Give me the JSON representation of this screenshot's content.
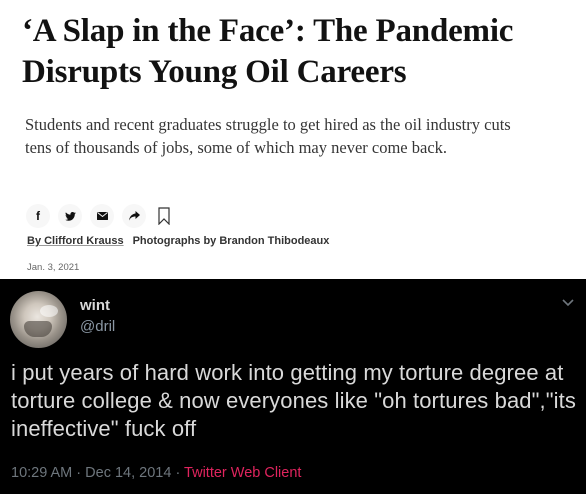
{
  "article": {
    "headline": "‘A Slap in the Face’: The Pandemic Disrupts Young Oil Careers",
    "summary": "Students and recent graduates struggle to get hired as the oil industry cuts tens of thousands of jobs, some of which may never come back.",
    "share_icons": [
      "facebook-icon",
      "twitter-icon",
      "email-icon",
      "share-arrow-icon",
      "bookmark-icon"
    ],
    "byline_author": "By Clifford Krauss",
    "byline_photos": "Photographs by Brandon Thibodeaux",
    "date": "Jan. 3, 2021"
  },
  "tweet": {
    "display_name": "wint",
    "handle": "@dril",
    "text": "i put years of hard work into getting my torture degree at torture college & now everyones like \"oh tortures bad\",\"its ineffective\" fuck off",
    "time": "10:29 AM",
    "separator": " · ",
    "date": "Dec 14, 2014",
    "client": "Twitter Web Client",
    "colors": {
      "background": "#000000",
      "text": "#d9d9d9",
      "muted": "#6e767d",
      "client": "#e0245e"
    }
  }
}
